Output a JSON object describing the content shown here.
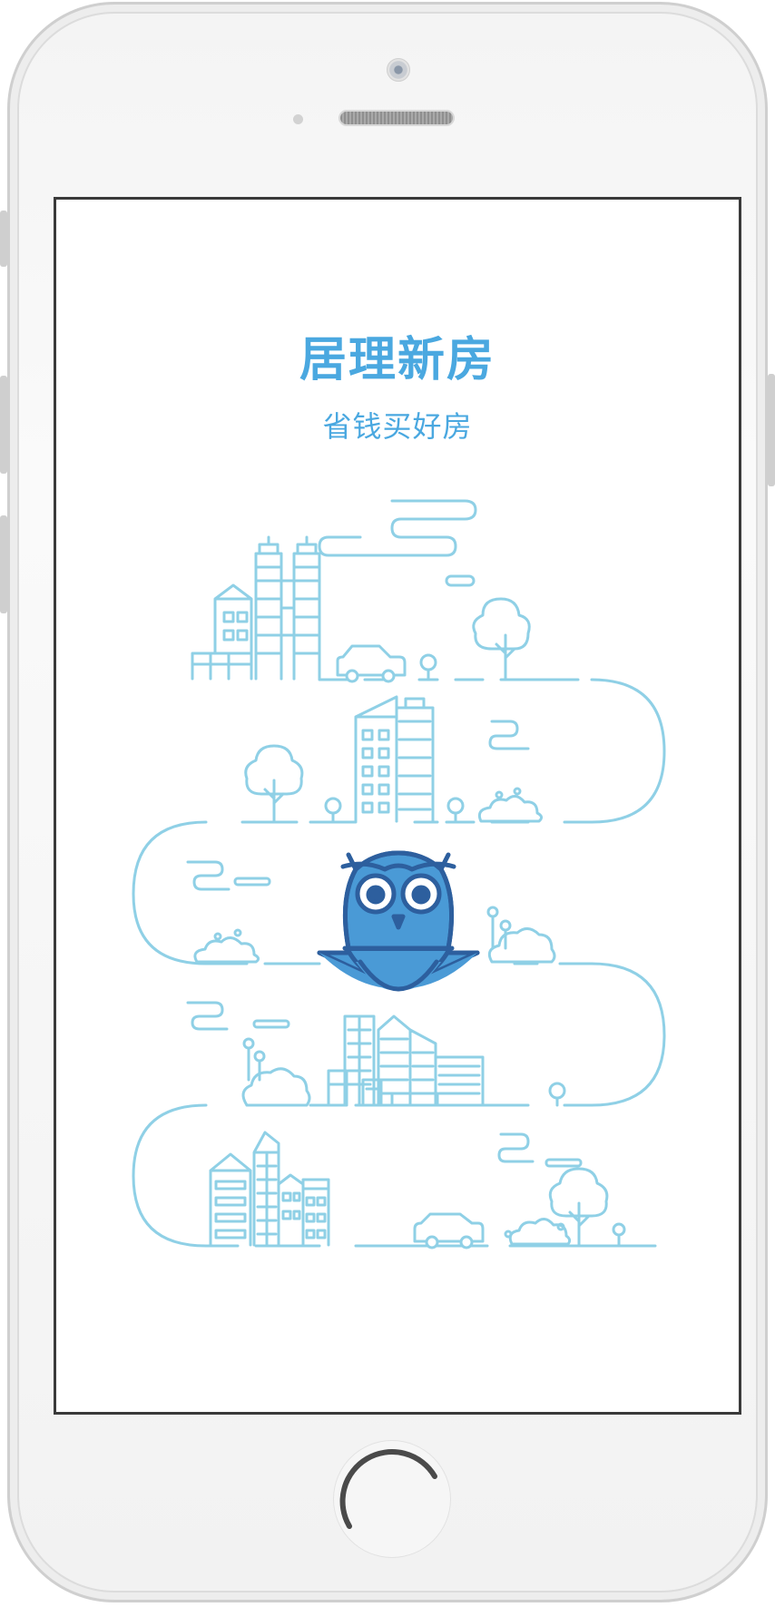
{
  "app": {
    "title": "居理新房",
    "slogan": "省钱买好房"
  },
  "icons": {
    "mascot": "owl-location-pin-icon",
    "scene": "city-road-illustration"
  },
  "colors": {
    "brand": "#4aa8e0",
    "line": "#8fd0e6",
    "owl_dark": "#2d5f9e",
    "owl_mid": "#4a9ad6"
  }
}
